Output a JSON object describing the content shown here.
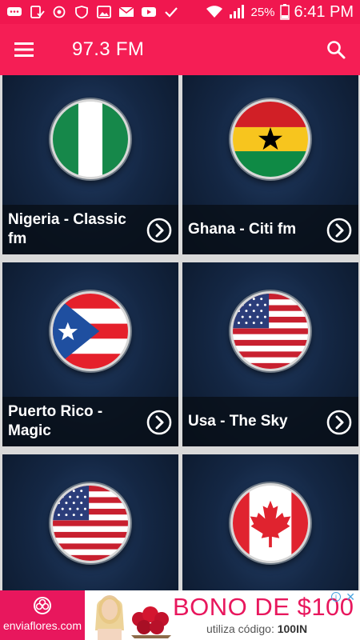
{
  "status_bar": {
    "battery": "25%",
    "time": "6:41 PM"
  },
  "app_bar": {
    "title": "97.3 FM"
  },
  "stations": [
    {
      "label": "Nigeria - Classic fm",
      "flag": "nigeria-flag"
    },
    {
      "label": "Ghana - Citi fm",
      "flag": "ghana-flag"
    },
    {
      "label": "Puerto Rico - Magic",
      "flag": "puerto-rico-flag"
    },
    {
      "label": "Usa - The Sky",
      "flag": "usa-flag"
    },
    {
      "label": "",
      "flag": "usa-flag"
    },
    {
      "label": "",
      "flag": "canada-flag"
    }
  ],
  "ad": {
    "brand": "enviaflores.com",
    "headline": "BONO DE $100",
    "sub_prefix": "utiliza código:",
    "sub_code": "100IN"
  },
  "colors": {
    "accent": "#f51e55",
    "ad_pink": "#e8175d"
  }
}
